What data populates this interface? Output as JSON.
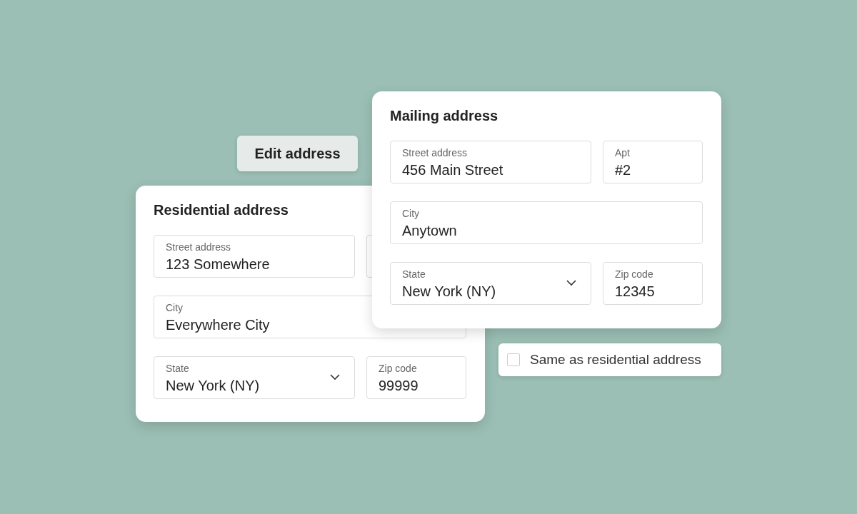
{
  "edit_button": {
    "label": "Edit address"
  },
  "residential_card": {
    "title": "Residential address",
    "rows": [
      [
        {
          "kind": "text",
          "label": "Street address",
          "value": "123 Somewhere"
        },
        {
          "kind": "covered"
        }
      ],
      [
        {
          "kind": "text",
          "label": "City",
          "value": "Everywhere City"
        }
      ],
      [
        {
          "kind": "select",
          "label": "State",
          "value": "New York (NY)"
        },
        {
          "kind": "text",
          "label": "Zip code",
          "value": "99999"
        }
      ]
    ]
  },
  "mailing_card": {
    "title": "Mailing address",
    "rows": [
      [
        {
          "kind": "text",
          "label": "Street address",
          "value": "456 Main Street"
        },
        {
          "kind": "text",
          "label": "Apt",
          "value": "#2"
        }
      ],
      [
        {
          "kind": "text",
          "label": "City",
          "value": "Anytown"
        }
      ],
      [
        {
          "kind": "select",
          "label": "State",
          "value": "New York (NY)"
        },
        {
          "kind": "text",
          "label": "Zip code",
          "value": "12345"
        }
      ]
    ]
  },
  "same_as_checkbox": {
    "label": "Same as residential address",
    "checked": false
  }
}
